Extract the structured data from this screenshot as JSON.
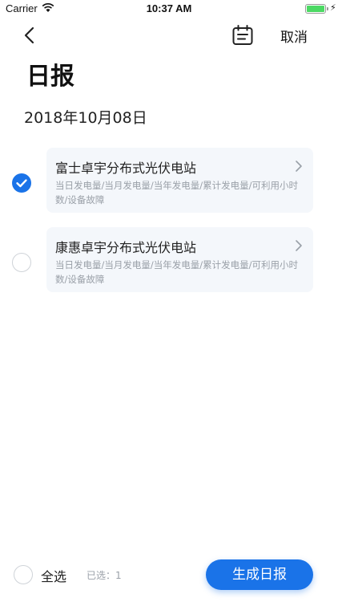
{
  "status_bar": {
    "carrier": "Carrier",
    "time": "10:37 AM"
  },
  "nav": {
    "cancel_label": "取消"
  },
  "page": {
    "title": "日报",
    "date": "2018年10月08日"
  },
  "stations": [
    {
      "name": "富士卓宇分布式光伏电站",
      "description": "当日发电量/当月发电量/当年发电量/累计发电量/可利用小时数/设备故障",
      "selected": true
    },
    {
      "name": "康惠卓宇分布式光伏电站",
      "description": "当日发电量/当月发电量/当年发电量/累计发电量/可利用小时数/设备故障",
      "selected": false
    }
  ],
  "footer": {
    "select_all_label": "全选",
    "selected_count": "已选：1",
    "generate_label": "生成日报"
  },
  "colors": {
    "accent": "#1a73e8",
    "card_bg": "#f4f7fb",
    "muted_text": "#9aa0a8"
  },
  "icons": {
    "back": "chevron-left-icon",
    "calendar": "calendar-icon",
    "check": "checkmark-icon",
    "row_arrow": "chevron-right-icon"
  }
}
